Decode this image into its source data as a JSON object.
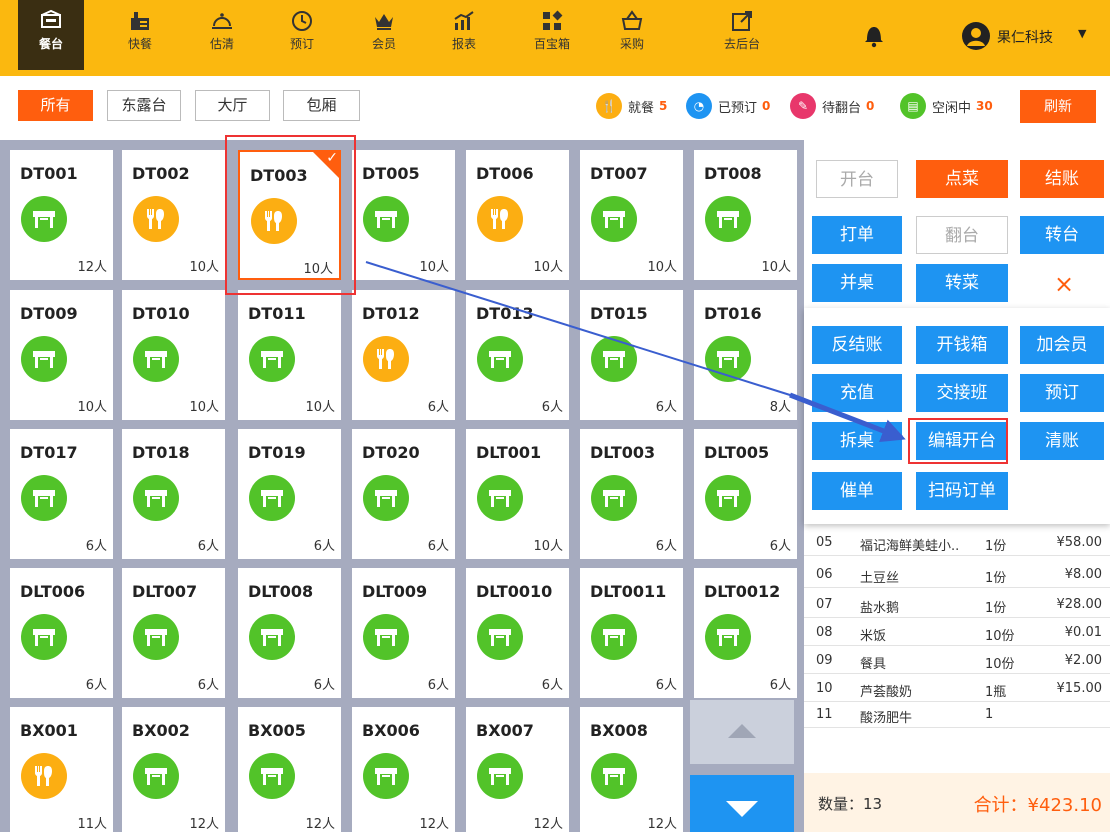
{
  "nav": [
    {
      "label": "餐台",
      "icon": "table-icon"
    },
    {
      "label": "快餐",
      "icon": "fastfood-icon"
    },
    {
      "label": "估清",
      "icon": "cloche-icon"
    },
    {
      "label": "预订",
      "icon": "clock-icon"
    },
    {
      "label": "会员",
      "icon": "crown-icon"
    },
    {
      "label": "报表",
      "icon": "chart-icon"
    },
    {
      "label": "百宝箱",
      "icon": "grid-icon"
    },
    {
      "label": "采购",
      "icon": "basket-icon"
    },
    {
      "label": "去后台",
      "icon": "external-icon"
    }
  ],
  "user": {
    "name": "果仁科技"
  },
  "filters": [
    "所有",
    "东露台",
    "大厅",
    "包厢"
  ],
  "legend": [
    {
      "label": "就餐",
      "count": "5",
      "color": "#FCAE12"
    },
    {
      "label": "已预订",
      "count": "0",
      "color": "#1E94F2"
    },
    {
      "label": "待翻台",
      "count": "0",
      "color": "#E8376B"
    },
    {
      "label": "空闲中",
      "count": "30",
      "color": "#52C329"
    }
  ],
  "refresh_label": "刷新",
  "tables": [
    {
      "code": "DT001",
      "seats": "12人",
      "status": "free"
    },
    {
      "code": "DT002",
      "seats": "10人",
      "status": "dining"
    },
    {
      "code": "DT003",
      "seats": "10人",
      "status": "dining",
      "selected": true
    },
    {
      "code": "DT005",
      "seats": "10人",
      "status": "free"
    },
    {
      "code": "DT006",
      "seats": "10人",
      "status": "dining"
    },
    {
      "code": "DT007",
      "seats": "10人",
      "status": "free"
    },
    {
      "code": "DT008",
      "seats": "10人",
      "status": "free"
    },
    {
      "code": "DT009",
      "seats": "10人",
      "status": "free"
    },
    {
      "code": "DT010",
      "seats": "10人",
      "status": "free"
    },
    {
      "code": "DT011",
      "seats": "10人",
      "status": "free"
    },
    {
      "code": "DT012",
      "seats": "6人",
      "status": "dining"
    },
    {
      "code": "DT013",
      "seats": "6人",
      "status": "free"
    },
    {
      "code": "DT015",
      "seats": "6人",
      "status": "free"
    },
    {
      "code": "DT016",
      "seats": "8人",
      "status": "free"
    },
    {
      "code": "DT017",
      "seats": "6人",
      "status": "free"
    },
    {
      "code": "DT018",
      "seats": "6人",
      "status": "free"
    },
    {
      "code": "DT019",
      "seats": "6人",
      "status": "free"
    },
    {
      "code": "DT020",
      "seats": "6人",
      "status": "free"
    },
    {
      "code": "DLT001",
      "seats": "10人",
      "status": "free"
    },
    {
      "code": "DLT003",
      "seats": "6人",
      "status": "free"
    },
    {
      "code": "DLT005",
      "seats": "6人",
      "status": "free"
    },
    {
      "code": "DLT006",
      "seats": "6人",
      "status": "free"
    },
    {
      "code": "DLT007",
      "seats": "6人",
      "status": "free"
    },
    {
      "code": "DLT008",
      "seats": "6人",
      "status": "free"
    },
    {
      "code": "DLT009",
      "seats": "6人",
      "status": "free"
    },
    {
      "code": "DLT0010",
      "seats": "6人",
      "status": "free"
    },
    {
      "code": "DLT0011",
      "seats": "6人",
      "status": "free"
    },
    {
      "code": "DLT0012",
      "seats": "6人",
      "status": "free"
    },
    {
      "code": "BX001",
      "seats": "11人",
      "status": "dining"
    },
    {
      "code": "BX002",
      "seats": "12人",
      "status": "free"
    },
    {
      "code": "BX005",
      "seats": "12人",
      "status": "free"
    },
    {
      "code": "BX006",
      "seats": "12人",
      "status": "free"
    },
    {
      "code": "BX007",
      "seats": "12人",
      "status": "free"
    },
    {
      "code": "BX008",
      "seats": "12人",
      "status": "free"
    }
  ],
  "actions": {
    "open": "开台",
    "order": "点菜",
    "checkout": "结账",
    "print": "打单",
    "turn": "翻台",
    "transfer": "转台",
    "merge": "并桌",
    "move_dish": "转菜",
    "close": "×"
  },
  "more_actions": {
    "reverse_checkout": "反结账",
    "open_cashbox": "开钱箱",
    "add_member": "加会员",
    "recharge": "充值",
    "shift_handover": "交接班",
    "reserve": "预订",
    "split_table": "拆桌",
    "edit_open": "编辑开台",
    "clear_account": "清账",
    "urge": "催单",
    "qr_order": "扫码订单"
  },
  "order_items": [
    {
      "no": "05",
      "name": "福记海鲜美蛙小..",
      "qty": "1份",
      "price": "¥58.00"
    },
    {
      "no": "06",
      "name": "土豆丝",
      "qty": "1份",
      "price": "¥8.00"
    },
    {
      "no": "07",
      "name": "盐水鹅",
      "qty": "1份",
      "price": "¥28.00"
    },
    {
      "no": "08",
      "name": "米饭",
      "qty": "10份",
      "price": "¥0.01"
    },
    {
      "no": "09",
      "name": "餐具",
      "qty": "10份",
      "price": "¥2.00"
    },
    {
      "no": "10",
      "name": "芦荟酸奶",
      "qty": "1瓶",
      "price": "¥15.00"
    },
    {
      "no": "11",
      "name": "酸汤肥牛",
      "qty": "1",
      "price": ""
    }
  ],
  "summary": {
    "qty": "数量：13",
    "total": "合计：¥423.10"
  }
}
